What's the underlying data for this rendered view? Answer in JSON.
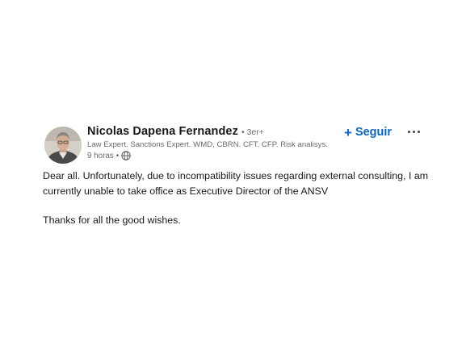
{
  "post": {
    "author": {
      "name": "Nicolas Dapena Fernandez",
      "degree": "• 3er+",
      "headline": "Law Expert. Sanctions Expert. WMD, CBRN. CFT. CFP. Risk analisys.",
      "time": "9 horas",
      "separator": "•",
      "visibility_icon": "globe-icon",
      "avatar_icon": "profile-photo"
    },
    "actions": {
      "follow_icon": "+",
      "follow_label": "Seguir",
      "more_icon": "ellipsis-icon"
    },
    "body": {
      "paragraphs": [
        "Dear all. Unfortunately, due to incompatibility issues regarding external consulting, I am currently unable to take office as Executive Director of the ANSV",
        "Thanks for all the good wishes."
      ]
    }
  },
  "colors": {
    "accent": "#0a66c2",
    "text_primary": "#1a1a1a",
    "text_secondary": "#666666"
  }
}
